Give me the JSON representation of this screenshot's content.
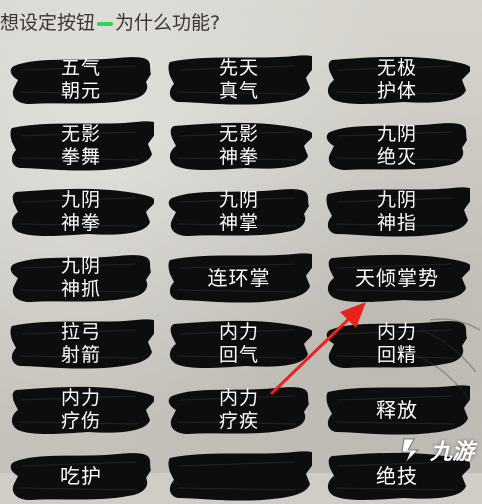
{
  "prompt": {
    "before": "想设定按钮",
    "after": "为什么功能?",
    "dash_color": "#2fd05a"
  },
  "buttons": [
    {
      "line1": "五气",
      "line2": "朝元"
    },
    {
      "line1": "先天",
      "line2": "真气"
    },
    {
      "line1": "无极",
      "line2": "护体"
    },
    {
      "line1": "无影",
      "line2": "拳舞"
    },
    {
      "line1": "无影",
      "line2": "神拳"
    },
    {
      "line1": "九阴",
      "line2": "绝灭"
    },
    {
      "line1": "九阴",
      "line2": "神拳"
    },
    {
      "line1": "九阴",
      "line2": "神掌"
    },
    {
      "line1": "九阴",
      "line2": "神指"
    },
    {
      "line1": "九阴",
      "line2": "神抓"
    },
    {
      "line1": "连环掌",
      "line2": ""
    },
    {
      "line1": "天倾掌势",
      "line2": ""
    },
    {
      "line1": "拉弓",
      "line2": "射箭"
    },
    {
      "line1": "内力",
      "line2": "回气"
    },
    {
      "line1": "内力",
      "line2": "回精"
    },
    {
      "line1": "内力",
      "line2": "疗伤"
    },
    {
      "line1": "内力",
      "line2": "疗疾"
    },
    {
      "line1": "释放",
      "line2": ""
    },
    {
      "line1": "吃护",
      "line2": ""
    },
    {
      "line1": "",
      "line2": ""
    },
    {
      "line1": "绝技",
      "line2": ""
    }
  ],
  "arrow": {
    "color": "#e8231e",
    "points_to": "天倾掌势"
  },
  "watermark": {
    "text": "九游",
    "icon": "jiuyou-logo-icon"
  }
}
